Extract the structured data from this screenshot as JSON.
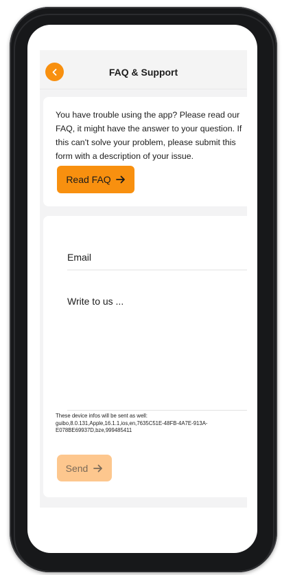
{
  "header": {
    "title": "FAQ & Support",
    "back_icon": "chevron-left-icon"
  },
  "faq_card": {
    "intro_text": "You have trouble using the app? Please read our FAQ, it might have the answer to your question. If this can't solve your problem, please submit this form with a description of your issue.",
    "read_faq_label": "Read FAQ",
    "read_faq_icon": "arrow-right-icon"
  },
  "form": {
    "email_placeholder": "Email",
    "message_placeholder": "Write to us ...",
    "device_info_note": "These device infos will be sent as well: guibo,8.0.131,Apple,16.1.1,ios,en,7635C51E-48FB-4A7E-913A-E078BE69937D,bze,999485411",
    "send_label": "Send",
    "send_icon": "arrow-right-icon"
  },
  "colors": {
    "accent": "#f8900f",
    "accent_disabled": "#fdc78e",
    "background": "#f3f3f4",
    "card": "#ffffff"
  }
}
